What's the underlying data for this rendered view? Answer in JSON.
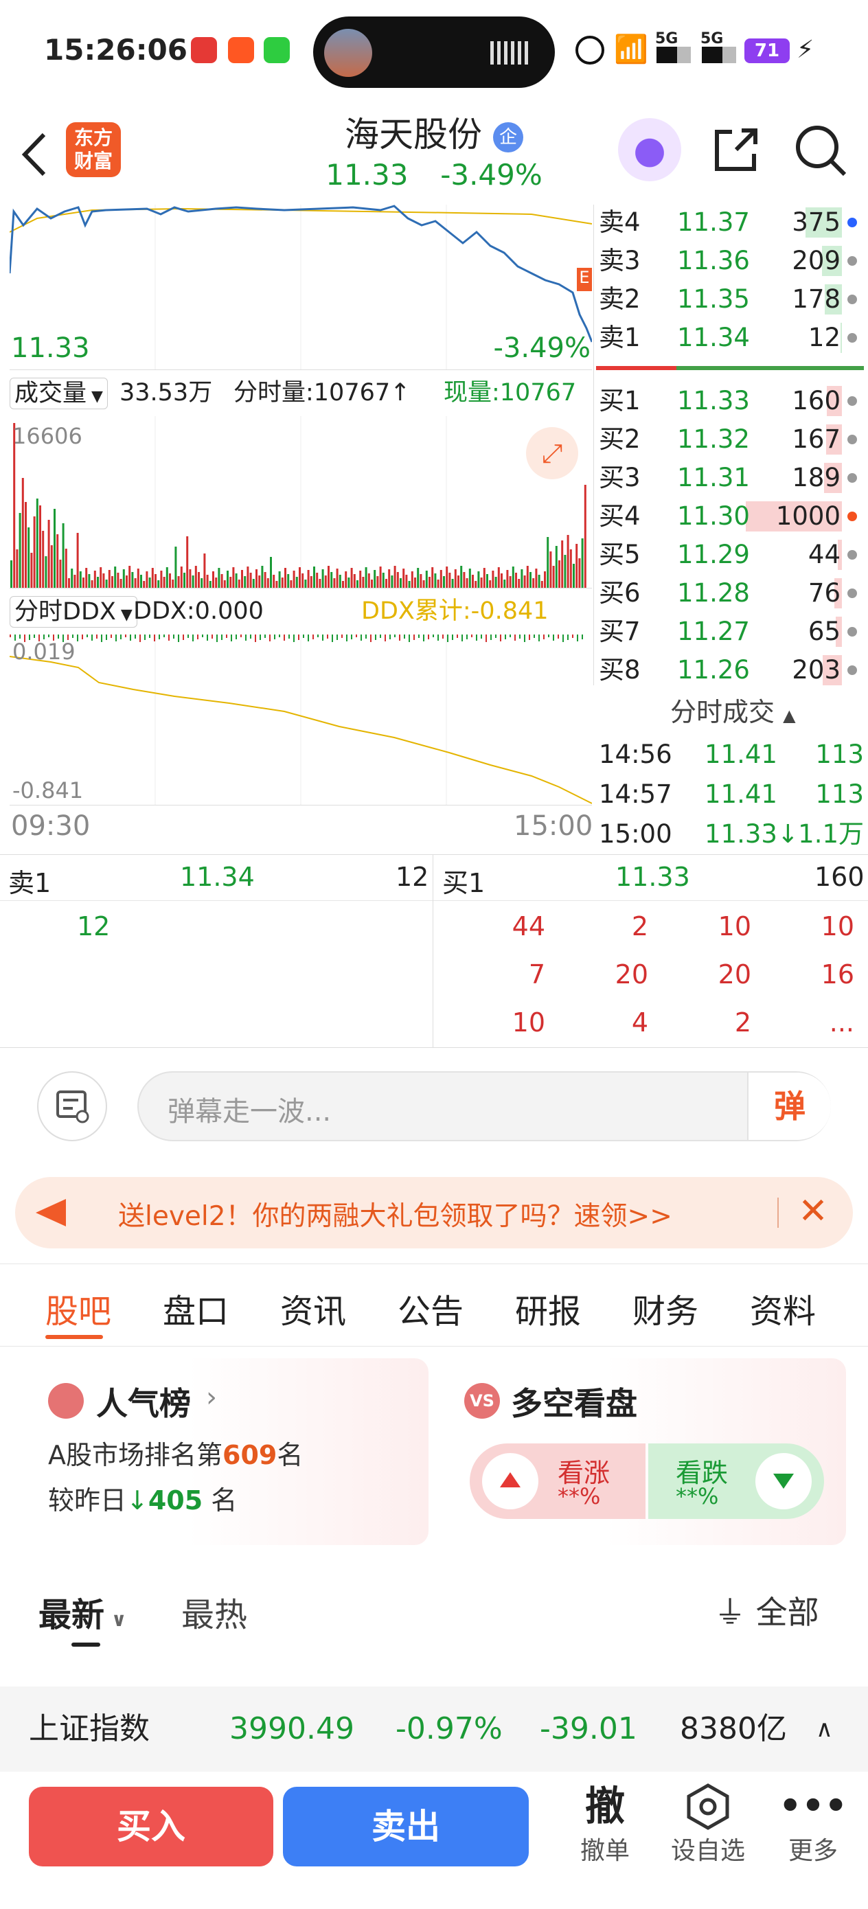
{
  "status_bar": {
    "time": "15:26:06",
    "battery": "71",
    "signal_1": "5G",
    "signal_2": "5G"
  },
  "header": {
    "logo_line1": "东方",
    "logo_line2": "财富",
    "stock_name": "海天股份",
    "badge": "企",
    "price": "11.33",
    "change_pct": "-3.49%"
  },
  "price_chart": {
    "price_label": "11.33",
    "pct_label": "-3.49%",
    "right_tag": "E"
  },
  "volume_bar": {
    "selector_label": "成交量",
    "volume": "33.53万",
    "tick_vol_label": "分时量:10767↑",
    "current_label": "现量:10767",
    "max_label": "16606"
  },
  "ddx_bar": {
    "selector_label": "分时DDX",
    "ddx_label": "DDX:0.000",
    "ddx_cum_label": "DDX累计:-0.841",
    "top_label": "0.019",
    "bottom_label": "-0.841"
  },
  "time_axis": {
    "start": "09:30",
    "end": "15:00"
  },
  "order_book": {
    "asks": [
      {
        "label": "卖4",
        "price": "11.37",
        "qty": "375",
        "dot": "#2962ff"
      },
      {
        "label": "卖3",
        "price": "11.36",
        "qty": "209",
        "dot": "#999999"
      },
      {
        "label": "卖2",
        "price": "11.35",
        "qty": "178",
        "dot": "#999999"
      },
      {
        "label": "卖1",
        "price": "11.34",
        "qty": "12",
        "dot": "#999999"
      }
    ],
    "bids": [
      {
        "label": "买1",
        "price": "11.33",
        "qty": "160",
        "dot": "#999999"
      },
      {
        "label": "买2",
        "price": "11.32",
        "qty": "167",
        "dot": "#999999"
      },
      {
        "label": "买3",
        "price": "11.31",
        "qty": "189",
        "dot": "#999999"
      },
      {
        "label": "买4",
        "price": "11.30",
        "qty": "1000",
        "dot": "#f4511e"
      },
      {
        "label": "买5",
        "price": "11.29",
        "qty": "44",
        "dot": "#999999"
      },
      {
        "label": "买6",
        "price": "11.28",
        "qty": "76",
        "dot": "#999999"
      },
      {
        "label": "买7",
        "price": "11.27",
        "qty": "65",
        "dot": "#999999"
      },
      {
        "label": "买8",
        "price": "11.26",
        "qty": "203",
        "dot": "#999999"
      }
    ]
  },
  "ticks": {
    "title": "分时成交",
    "rows": [
      {
        "time": "14:56",
        "price": "11.41",
        "vol": "113"
      },
      {
        "time": "14:57",
        "price": "11.41",
        "vol": "113"
      },
      {
        "time": "15:00",
        "price": "11.33↓",
        "vol": "1.1万"
      }
    ]
  },
  "queue": {
    "sell_label": "卖1",
    "sell_price": "11.34",
    "sell_qty": "12",
    "buy_label": "买1",
    "buy_price": "11.33",
    "buy_qty": "160",
    "sell_orders": [
      "12"
    ],
    "buy_orders": [
      "44",
      "2",
      "10",
      "10",
      "7",
      "20",
      "20",
      "16",
      "10",
      "4",
      "2",
      "..."
    ]
  },
  "danmaku": {
    "placeholder": "弹幕走一波...",
    "send_label": "弹"
  },
  "banner": {
    "text": "送level2！你的两融大礼包领取了吗？速领>>"
  },
  "tabs": [
    "股吧",
    "盘口",
    "资讯",
    "公告",
    "研报",
    "财务",
    "资料"
  ],
  "popularity": {
    "title": "人气榜",
    "rank_prefix": "A股市场排名第",
    "rank": "609",
    "rank_suffix": "名",
    "compare_prefix": "较昨日",
    "compare_value": "405",
    "compare_suffix": "名"
  },
  "vs_panel": {
    "title": "多空看盘",
    "up_label": "看涨",
    "up_value": "**%",
    "down_label": "看跌",
    "down_value": "**%"
  },
  "feed_filter": {
    "latest": "最新",
    "hottest": "最热",
    "all": "全部"
  },
  "index_bar": {
    "name": "上证指数",
    "value": "3990.49",
    "pct": "-0.97%",
    "change": "-39.01",
    "turnover": "8380亿"
  },
  "bottom_bar": {
    "buy": "买入",
    "sell": "卖出",
    "cancel_icon": "撤",
    "cancel": "撤单",
    "watch": "设自选",
    "more": "更多"
  }
}
